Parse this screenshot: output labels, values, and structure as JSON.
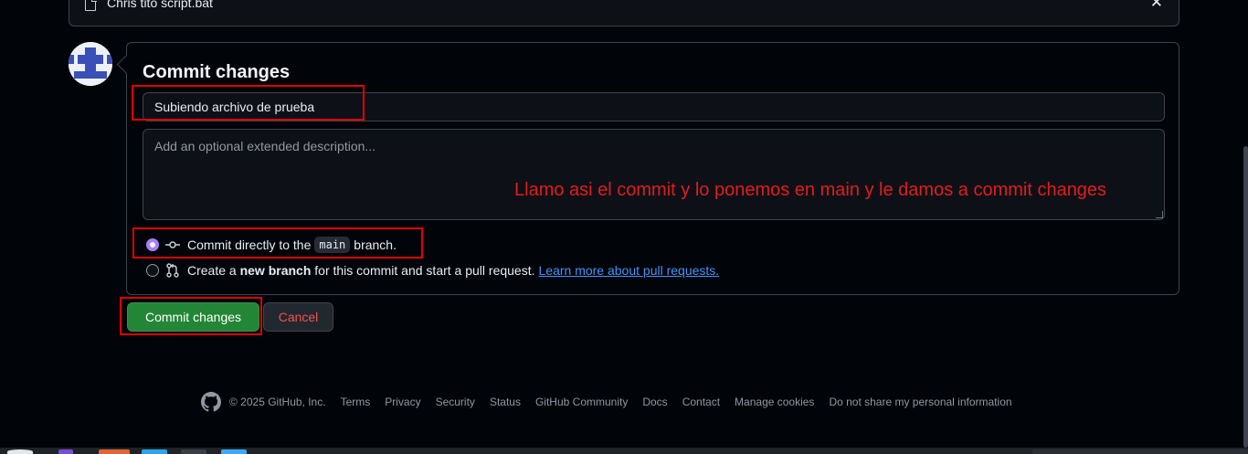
{
  "file_bar": {
    "filename": "Chris tito script.bat",
    "close_icon": "close-icon"
  },
  "commit_form": {
    "title": "Commit changes",
    "summary_value": "Subiendo archivo de prueba",
    "description_placeholder": "Add an optional extended description...",
    "option_direct": {
      "prefix": "Commit directly to the",
      "branch": "main",
      "suffix": "branch.",
      "selected": true,
      "icon": "git-commit-icon"
    },
    "option_new_branch": {
      "prefix": "Create a",
      "bold": "new branch",
      "suffix": "for this commit and start a pull request.",
      "link": "Learn more about pull requests.",
      "selected": false,
      "icon": "git-pull-request-icon"
    },
    "commit_button": "Commit changes",
    "cancel_button": "Cancel"
  },
  "annotation": "Llamo asi el commit y lo ponemos en main y le damos a commit changes",
  "footer": {
    "copyright": "© 2025 GitHub, Inc.",
    "links": [
      "Terms",
      "Privacy",
      "Security",
      "Status",
      "GitHub Community",
      "Docs",
      "Contact",
      "Manage cookies",
      "Do not share my personal information"
    ]
  },
  "colors": {
    "background": "#010409",
    "primary_button": "#238636",
    "cancel_text": "#f85149",
    "radio_accent": "#ab7df8",
    "link": "#4493f8",
    "highlight": "#e00000",
    "annotation": "#e31c1c"
  }
}
